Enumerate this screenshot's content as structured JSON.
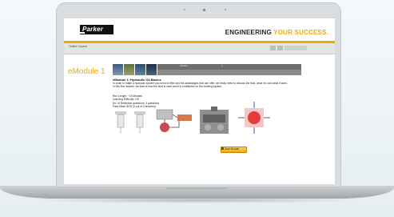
{
  "header": {
    "logo_text": "Parker",
    "tagline_pre": "ENGINEERING ",
    "tagline_accent": "YOUR SUCCESS.",
    "brand_color": "#f5a800"
  },
  "nav": {
    "item": "Online Course"
  },
  "module": {
    "title": "eModule 1",
    "heading": "eModule 1: Hydraulic Oil Basics",
    "paragraph": "In order to make a hydraulic system you need to filter and the advantages that can offer, we firstly need to discuss the fluid, what it is and what it does. In this first module, we look at how the fluid is used and it's contribution to the working system.",
    "info": [
      "Run Length: ~15 Minutes",
      "Learning Difficulty: 1/5",
      "No. of Reflection questions: 3 questions",
      "Pass Mark: 80% (3 out of 4 answers)"
    ]
  },
  "strip": {
    "labels": [
      "eModule",
      "2"
    ]
  },
  "start_button": {
    "label": "Start Module"
  }
}
